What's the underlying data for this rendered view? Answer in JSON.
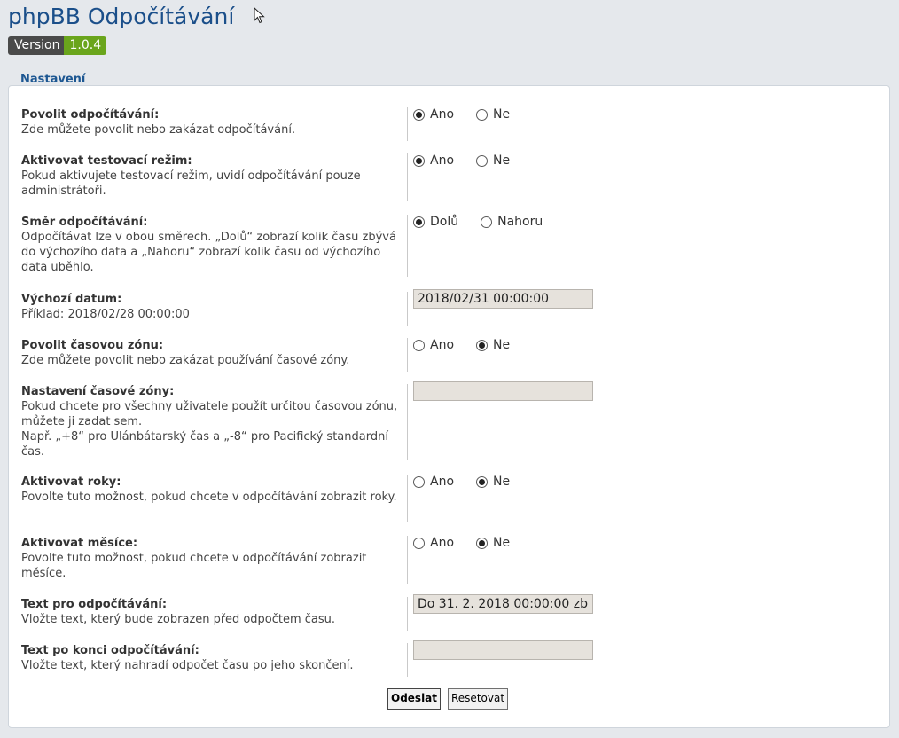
{
  "header": {
    "title": "phpBB Odpočítávání",
    "version_label": "Version",
    "version_number": "1.0.4"
  },
  "section": {
    "legend": "Nastavení"
  },
  "rows": [
    {
      "label": "Povolit odpočítávání:",
      "desc": "Zde můžete povolit nebo zakázat odpočítávání.",
      "type": "radio",
      "options": [
        "Ano",
        "Ne"
      ],
      "selected": "Ano"
    },
    {
      "label": "Aktivovat testovací režim:",
      "desc": "Pokud aktivujete testovací režim, uvidí odpočítávání pouze administrátoři.",
      "type": "radio",
      "options": [
        "Ano",
        "Ne"
      ],
      "selected": "Ano"
    },
    {
      "label": "Směr odpočítávání:",
      "desc": "Odpočítávat lze v obou směrech. „Dolů“ zobrazí kolik času zbývá do výchozího data a „Nahoru“ zobrazí kolik času od výchozího data uběhlo.",
      "type": "radio",
      "options": [
        "Dolů",
        "Nahoru"
      ],
      "selected": "Dolů"
    },
    {
      "label": "Výchozí datum:",
      "desc": "Příklad: 2018/02/28 00:00:00",
      "type": "text",
      "value": "2018/02/31 00:00:00"
    },
    {
      "label": "Povolit časovou zónu:",
      "desc": "Zde můžete povolit nebo zakázat používání časové zóny.",
      "type": "radio",
      "options": [
        "Ano",
        "Ne"
      ],
      "selected": "Ne"
    },
    {
      "label": "Nastavení časové zóny:",
      "desc": "Pokud chcete pro všechny uživatele použít určitou časovou zónu, můžete ji zadat sem.",
      "desc2": "Např. „+8“ pro Ulánbátarský čas a „-8“ pro Pacifický standardní čas.",
      "type": "text",
      "value": ""
    },
    {
      "label": "Aktivovat roky:",
      "desc": "Povolte tuto možnost, pokud chcete v odpočítávání zobrazit roky.",
      "type": "radio",
      "options": [
        "Ano",
        "Ne"
      ],
      "selected": "Ne"
    },
    {
      "label": "Aktivovat měsíce:",
      "desc": "Povolte tuto možnost, pokud chcete v odpočítávání zobrazit měsíce.",
      "type": "radio",
      "options": [
        "Ano",
        "Ne"
      ],
      "selected": "Ne"
    },
    {
      "label": "Text pro odpočítávání:",
      "desc": "Vložte text, který bude zobrazen před odpočtem času.",
      "type": "text",
      "value": "Do 31. 2. 2018 00:00:00 zb"
    },
    {
      "label": "Text po konci odpočítávání:",
      "desc": "Vložte text, který nahradí odpočet času po jeho skončení.",
      "type": "text",
      "value": ""
    }
  ],
  "buttons": {
    "submit": "Odeslat",
    "reset": "Resetovat"
  }
}
